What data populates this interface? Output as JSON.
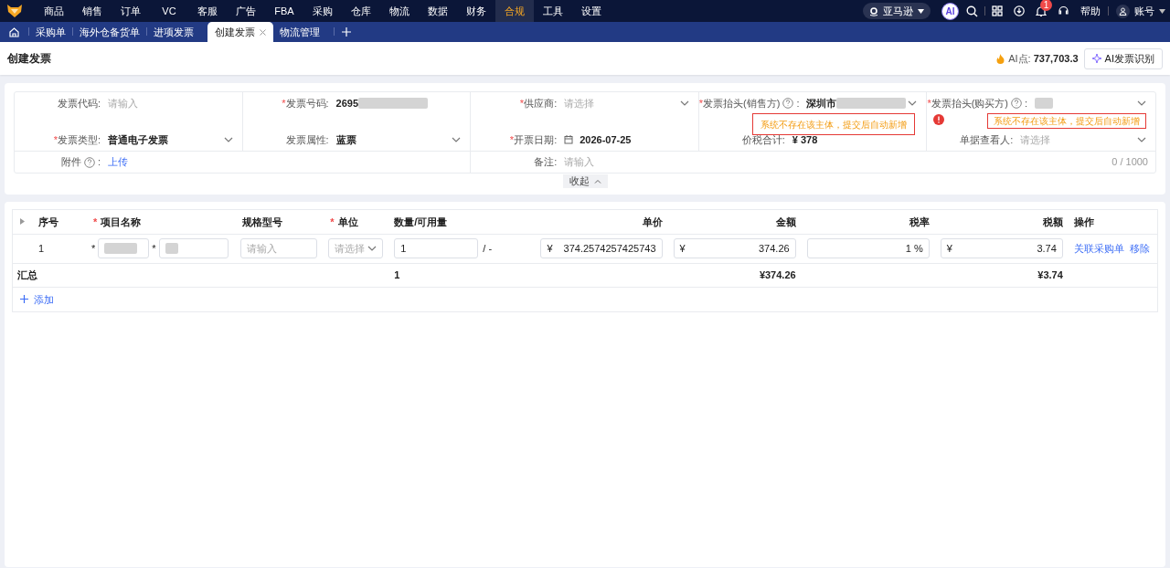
{
  "top_nav": {
    "items": [
      {
        "label": "商品",
        "selected": false
      },
      {
        "label": "销售",
        "selected": false
      },
      {
        "label": "订单",
        "selected": false
      },
      {
        "label": "VC",
        "selected": false
      },
      {
        "label": "客服",
        "selected": false
      },
      {
        "label": "广告",
        "selected": false
      },
      {
        "label": "FBA",
        "selected": false
      },
      {
        "label": "采购",
        "selected": false
      },
      {
        "label": "仓库",
        "selected": false
      },
      {
        "label": "物流",
        "selected": false
      },
      {
        "label": "数据",
        "selected": false
      },
      {
        "label": "财务",
        "selected": false
      },
      {
        "label": "合规",
        "selected": true
      },
      {
        "label": "工具",
        "selected": false
      },
      {
        "label": "设置",
        "selected": false
      }
    ],
    "marketplace": "亚马逊",
    "ai_badge": "AI",
    "notification_count": "1",
    "help": "帮助",
    "account": "账号"
  },
  "tabs": [
    {
      "label": "采购单",
      "selected": false
    },
    {
      "label": "海外仓备货单",
      "selected": false
    },
    {
      "label": "进项发票",
      "selected": false
    },
    {
      "label": "创建发票",
      "selected": true,
      "closable": true
    },
    {
      "label": "物流管理",
      "selected": false
    }
  ],
  "header": {
    "title": "创建发票",
    "ai_points_label": "AI点:",
    "ai_points": "737,703.3",
    "ai_button": "AI发票识别"
  },
  "form": {
    "fields": [
      {
        "label": "发票代码",
        "suffix": ":",
        "kind": "input",
        "placeholder": "请输入"
      },
      {
        "mark": "*",
        "label": "发票号码",
        "suffix": ":",
        "kind": "text",
        "value": "2695",
        "redacted": true
      },
      {
        "mark": "*",
        "label": "供应商",
        "suffix": ":",
        "kind": "select",
        "placeholder": "请选择"
      },
      {
        "mark": "*",
        "label": "发票抬头(销售方)",
        "suffix": ":",
        "help": true,
        "kind": "select",
        "value": "深圳市",
        "redacted": true,
        "warning": "系统不存在该主体，提交后自动新增"
      },
      {
        "mark": "*",
        "label": "发票抬头(购买方)",
        "suffix": ":",
        "help": true,
        "kind": "select",
        "redacted": true,
        "error": true,
        "warning": "系统不存在该主体，提交后自动新增"
      },
      {
        "mark": "*",
        "label": "发票类型",
        "suffix": ":",
        "kind": "select",
        "value": "普通电子发票"
      },
      {
        "label": "发票属性",
        "suffix": ":",
        "kind": "select",
        "value": "蓝票"
      },
      {
        "mark": "*",
        "label": "开票日期",
        "suffix": ":",
        "kind": "date",
        "value": "2026-07-25"
      },
      {
        "label": "价税合计",
        "suffix": ":",
        "kind": "text",
        "value": "¥ 378"
      },
      {
        "label": "单据查看人",
        "suffix": ":",
        "kind": "select",
        "placeholder": "请选择"
      }
    ],
    "attachment": {
      "label": "附件",
      "help": true,
      "suffix": ":",
      "link": "上传"
    },
    "remark": {
      "label": "备注:",
      "placeholder": "请输入",
      "counter": "0 / 1000"
    },
    "collapse": "收起"
  },
  "table": {
    "columns": [
      {
        "label": "序号"
      },
      {
        "mark": "*",
        "label": "项目名称"
      },
      {
        "label": "规格型号"
      },
      {
        "mark": "*",
        "label": "单位"
      },
      {
        "label": "数量/可用量"
      },
      {
        "label": "单价"
      },
      {
        "label": "金额"
      },
      {
        "label": "税率"
      },
      {
        "label": "税额"
      },
      {
        "label": "操作"
      }
    ],
    "rows": [
      {
        "index": "1",
        "name_marks": [
          "*",
          "*"
        ],
        "spec_placeholder": "请输入",
        "unit_placeholder": "请选择",
        "quantity": "1",
        "available": "/ -",
        "price_currency": "¥",
        "unit_price": "374.2574257425743",
        "amount_currency": "¥",
        "amount": "374.26",
        "tax_rate": "1 %",
        "tax_currency": "¥",
        "tax": "3.74",
        "actions": [
          "关联采购单",
          "移除"
        ]
      }
    ],
    "summary": {
      "label": "汇总",
      "quantity": "1",
      "amount": "¥374.26",
      "tax": "¥3.74"
    },
    "add": "添加"
  }
}
